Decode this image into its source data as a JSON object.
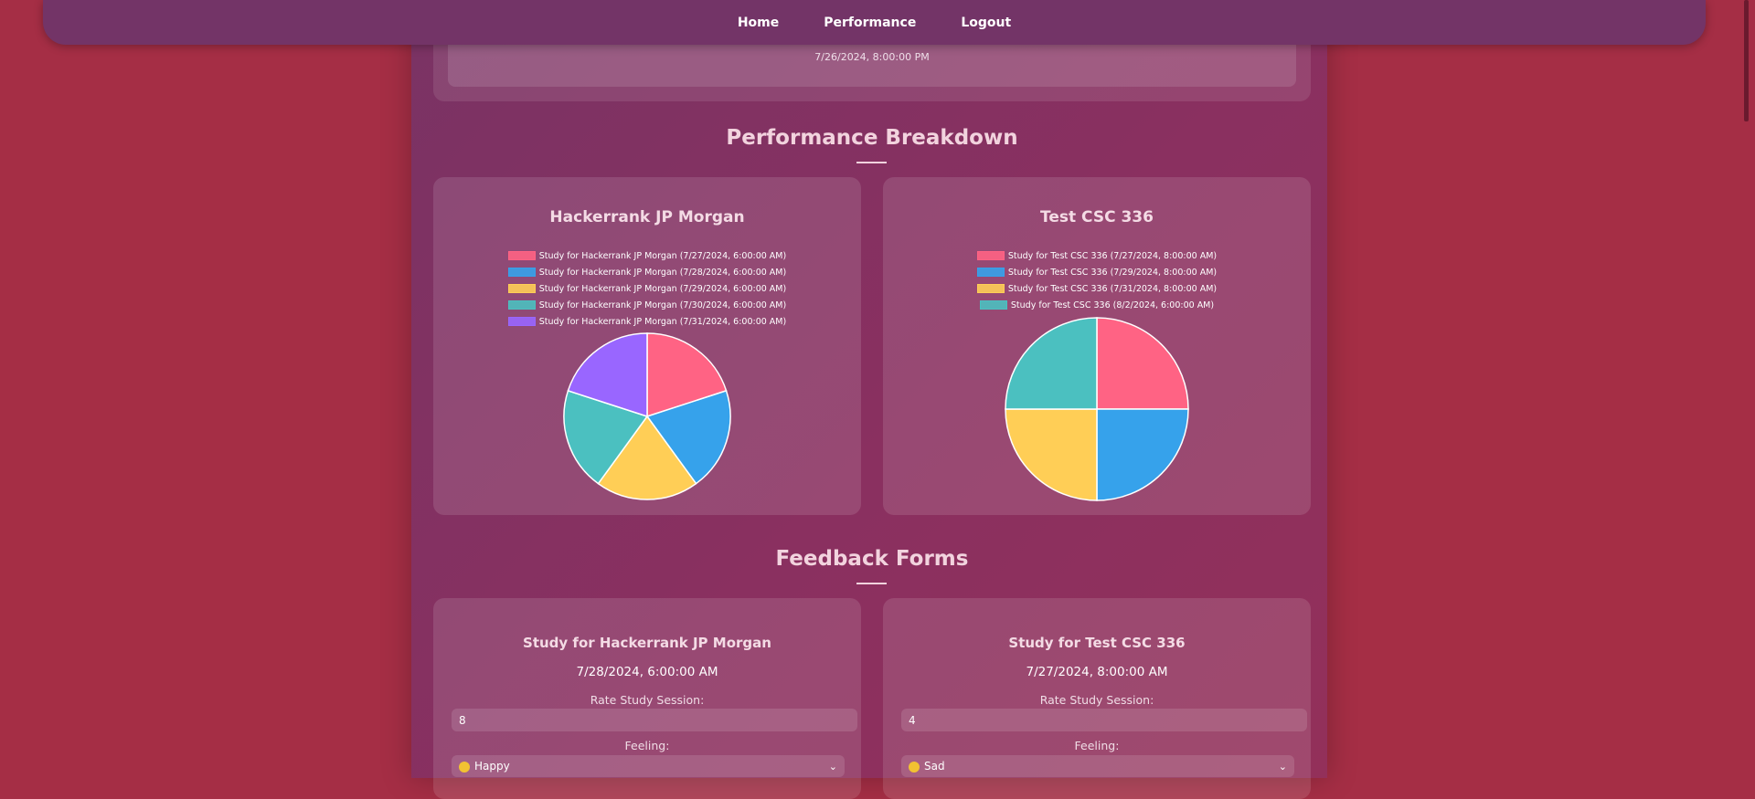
{
  "nav": {
    "items": [
      {
        "label": "Home"
      },
      {
        "label": "Performance"
      },
      {
        "label": "Logout"
      }
    ]
  },
  "top_card": {
    "date": "7/26/2024, 8:00:00 PM"
  },
  "performance": {
    "title": "Performance Breakdown",
    "charts": [
      {
        "title": "Hackerrank JP Morgan",
        "legend": [
          "Study for Hackerrank JP Morgan (7/27/2024, 6:00:00 AM)",
          "Study for Hackerrank JP Morgan (7/28/2024, 6:00:00 AM)",
          "Study for Hackerrank JP Morgan (7/29/2024, 6:00:00 AM)",
          "Study for Hackerrank JP Morgan (7/30/2024, 6:00:00 AM)",
          "Study for Hackerrank JP Morgan (7/31/2024, 6:00:00 AM)"
        ]
      },
      {
        "title": "Test CSC 336",
        "legend": [
          "Study for Test CSC 336 (7/27/2024, 8:00:00 AM)",
          "Study for Test CSC 336 (7/29/2024, 8:00:00 AM)",
          "Study for Test CSC 336 (7/31/2024, 8:00:00 AM)",
          "Study for Test CSC 336 (8/2/2024, 6:00:00 AM)"
        ]
      }
    ]
  },
  "chart_data": [
    {
      "type": "pie",
      "title": "Hackerrank JP Morgan",
      "categories": [
        "Study for Hackerrank JP Morgan (7/27/2024, 6:00:00 AM)",
        "Study for Hackerrank JP Morgan (7/28/2024, 6:00:00 AM)",
        "Study for Hackerrank JP Morgan (7/29/2024, 6:00:00 AM)",
        "Study for Hackerrank JP Morgan (7/30/2024, 6:00:00 AM)",
        "Study for Hackerrank JP Morgan (7/31/2024, 6:00:00 AM)"
      ],
      "values": [
        1,
        1,
        1,
        1,
        1
      ],
      "colors": [
        "#ff6384",
        "#36a2eb",
        "#ffce56",
        "#4bc0c0",
        "#9966ff"
      ],
      "legend_position": "top"
    },
    {
      "type": "pie",
      "title": "Test CSC 336",
      "categories": [
        "Study for Test CSC 336 (7/27/2024, 8:00:00 AM)",
        "Study for Test CSC 336 (7/29/2024, 8:00:00 AM)",
        "Study for Test CSC 336 (7/31/2024, 8:00:00 AM)",
        "Study for Test CSC 336 (8/2/2024, 6:00:00 AM)"
      ],
      "values": [
        1,
        1,
        1,
        1
      ],
      "colors": [
        "#ff6384",
        "#36a2eb",
        "#ffce56",
        "#4bc0c0"
      ],
      "legend_position": "top"
    }
  ],
  "feedback": {
    "title": "Feedback Forms",
    "forms": [
      {
        "title": "Study for Hackerrank JP Morgan",
        "date": "7/28/2024, 6:00:00 AM",
        "rate_label": "Rate Study Session:",
        "rate_value": "8",
        "feeling_label": "Feeling:",
        "feeling_value": "Happy"
      },
      {
        "title": "Study for Test CSC 336",
        "date": "7/27/2024, 8:00:00 AM",
        "rate_label": "Rate Study Session:",
        "rate_value": "4",
        "feeling_label": "Feeling:",
        "feeling_value": "Sad"
      }
    ]
  },
  "colors": {
    "background": "#a52e45",
    "navbar": "#733467",
    "heading": "#f2d3de"
  }
}
